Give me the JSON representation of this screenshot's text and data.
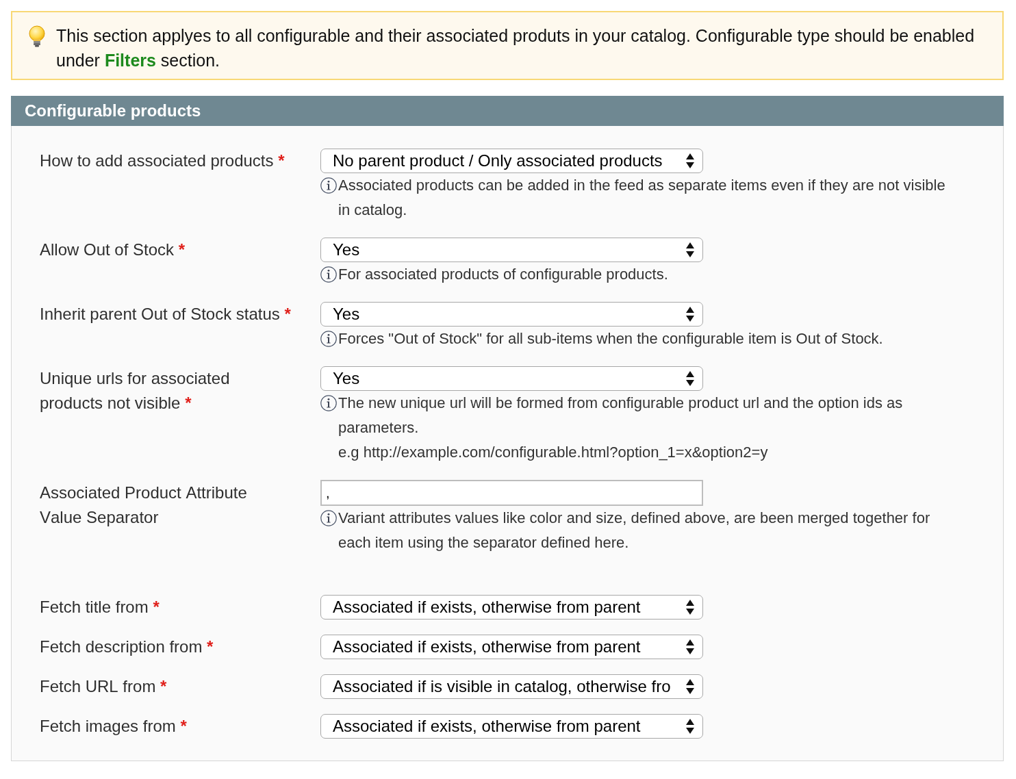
{
  "notice": {
    "text": "This section applyes to all configurable and their associated produts in your catalog. Configurable type should be enabled under **Filters** section."
  },
  "section": {
    "title": "Configurable products"
  },
  "fields": [
    {
      "label": "How to add associated products",
      "required_mark": "*",
      "kind": "select",
      "value": "No parent product / Only associated products",
      "note": [
        "Associated products can be added in the feed as separate items even if they are not visible in catalog."
      ]
    },
    {
      "label": "Allow Out of Stock",
      "required_mark": "*",
      "kind": "select",
      "value": "Yes",
      "note": [
        "For associated products of configurable products."
      ]
    },
    {
      "label": "Inherit parent Out of Stock status",
      "required_mark": "*",
      "kind": "select",
      "value": "Yes",
      "note": [
        "Forces \"Out of Stock\" for all sub-items when the configurable item is Out of Stock."
      ]
    },
    {
      "label": "Unique urls for associated products not visible",
      "required_mark": "*",
      "kind": "select",
      "value": "Yes",
      "note": [
        "The new unique url will be formed from configurable product url and the option ids as parameters.",
        "e.g http://example.com/configurable.html?option_1=x&option2=y"
      ]
    },
    {
      "label": "Associated Product Attribute Value Separator",
      "kind": "text",
      "value": ",",
      "note": [
        "Variant attributes values like color and size, defined above, are been merged together for each item using the separator defined here."
      ]
    }
  ],
  "fetch_fields": [
    {
      "label": "Fetch title from",
      "required_mark": "*",
      "kind": "select",
      "value": "Associated if exists, otherwise from parent"
    },
    {
      "label": "Fetch description from",
      "required_mark": "*",
      "kind": "select",
      "value": "Associated if exists, otherwise from parent"
    },
    {
      "label": "Fetch URL from",
      "required_mark": "*",
      "kind": "select",
      "value": "Associated if is visible in catalog, otherwise fro"
    },
    {
      "label": "Fetch images from",
      "required_mark": "*",
      "kind": "select",
      "value": "Associated if exists, otherwise from parent"
    }
  ]
}
